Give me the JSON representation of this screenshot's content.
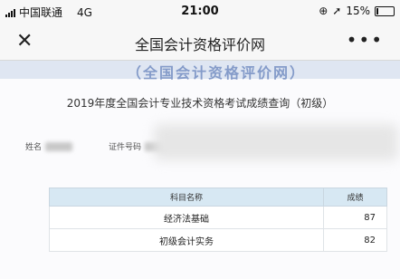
{
  "status_bar": {
    "carrier": "中国联通",
    "network": "4G",
    "time": "21:00",
    "battery": "15%",
    "battery_level": 0.15
  },
  "nav": {
    "title": "全国会计资格评价网",
    "close_icon": "close-icon",
    "more_icon": "more-icon"
  },
  "page": {
    "banner": "（全国会计资格评价网）",
    "heading": "2019年度全国会计专业技术资格考试成绩查询（初级）",
    "name_label": "姓名",
    "id_label": "证件号码"
  },
  "scores": {
    "headers": [
      "科目名称",
      "成绩"
    ],
    "rows": [
      {
        "subject": "经济法基础",
        "score": "87"
      },
      {
        "subject": "初级会计实务",
        "score": "82"
      }
    ]
  }
}
